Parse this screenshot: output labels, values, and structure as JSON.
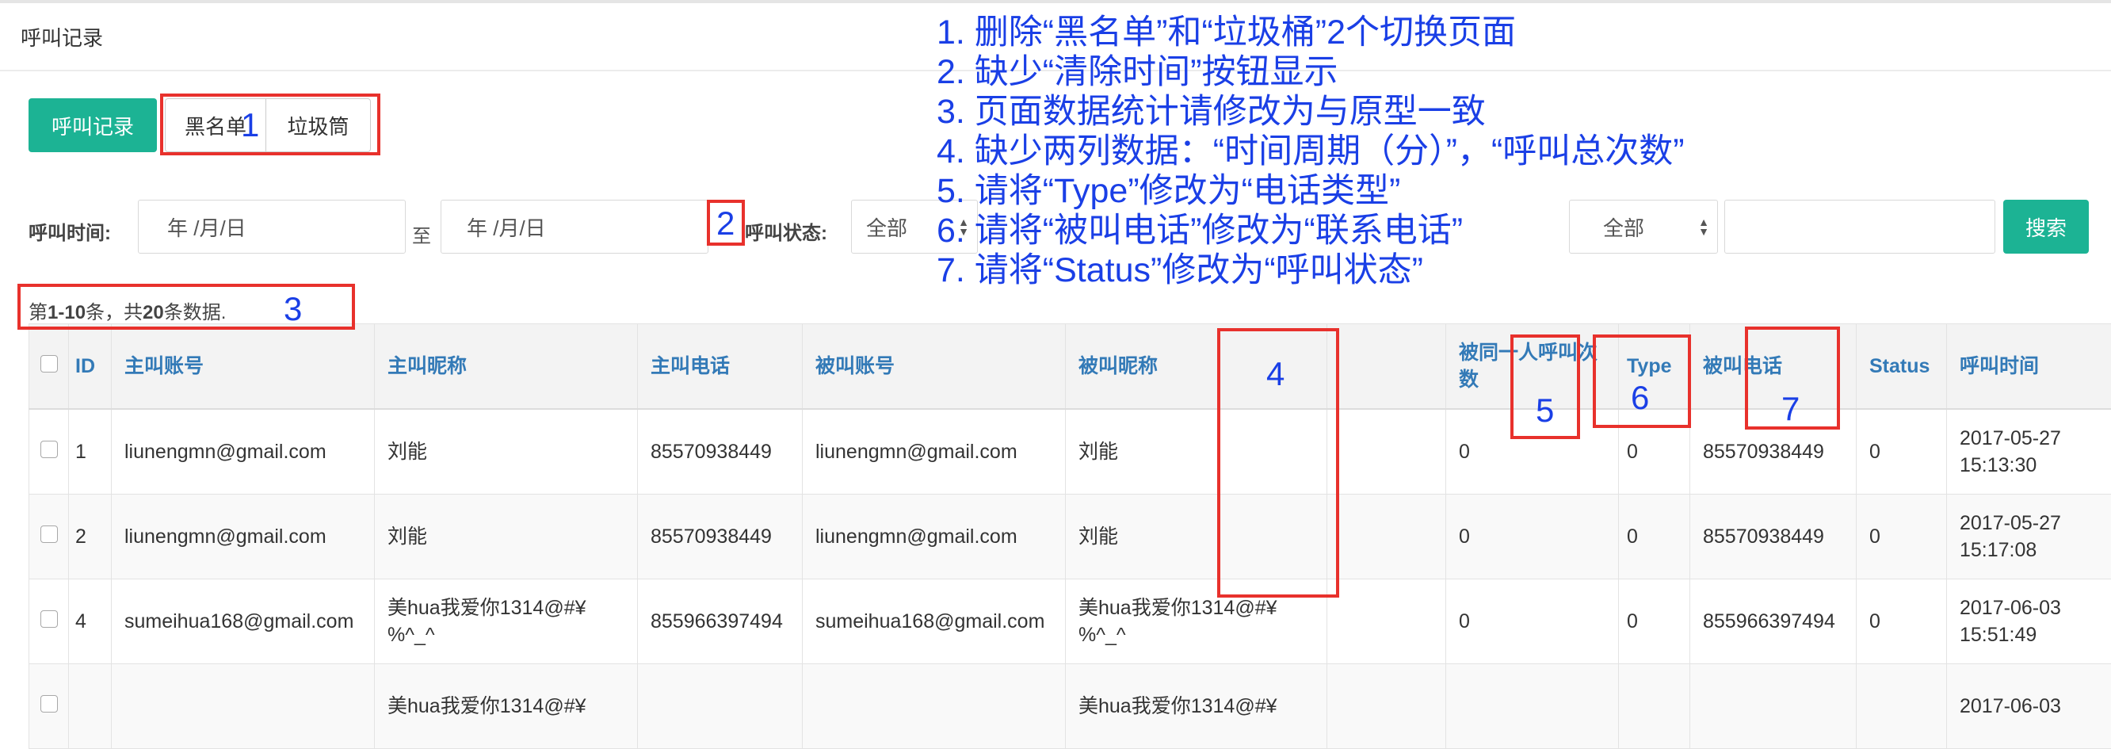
{
  "page": {
    "title": "呼叫记录"
  },
  "tabs": {
    "active": "呼叫记录",
    "blacklist": "黑名单",
    "trash": "垃圾筒"
  },
  "filters": {
    "call_time_label": "呼叫时间:",
    "date_from": "年 /月/日",
    "to_label": "至",
    "date_to": "年 /月/日",
    "call_status_label": "呼叫状态:",
    "status_value": "全部",
    "type_value": "全部",
    "keyword_value": "",
    "search_label": "搜索"
  },
  "summary": {
    "prefix": "第",
    "range": "1-10",
    "mid": "条，共",
    "total": "20",
    "suffix": "条数据."
  },
  "table": {
    "headers": {
      "id": "ID",
      "caller_account": "主叫账号",
      "caller_nickname": "主叫昵称",
      "caller_phone": "主叫电话",
      "callee_account": "被叫账号",
      "callee_nickname": "被叫昵称",
      "blank": "",
      "same_person_count": "被同一人呼叫次数",
      "type": "Type",
      "callee_phone": "被叫电话",
      "status": "Status",
      "call_time": "呼叫时间",
      "ops": ""
    },
    "rows": [
      {
        "id": "1",
        "caller_account": "liunengmn@gmail.com",
        "caller_nickname": "刘能",
        "caller_phone": "85570938449",
        "callee_account": "liunengmn@gmail.com",
        "callee_nickname": "刘能",
        "same_person_count": "0",
        "type": "0",
        "callee_phone": "85570938449",
        "status": "0",
        "call_date": "2017-05-27",
        "call_clock": "15:13:30"
      },
      {
        "id": "2",
        "caller_account": "liunengmn@gmail.com",
        "caller_nickname": "刘能",
        "caller_phone": "85570938449",
        "callee_account": "liunengmn@gmail.com",
        "callee_nickname": "刘能",
        "same_person_count": "0",
        "type": "0",
        "callee_phone": "85570938449",
        "status": "0",
        "call_date": "2017-05-27",
        "call_clock": "15:17:08"
      },
      {
        "id": "4",
        "caller_account": "sumeihua168@gmail.com",
        "caller_nickname": "美hua我爱你1314@#¥%^_^",
        "caller_phone": "855966397494",
        "callee_account": "sumeihua168@gmail.com",
        "callee_nickname": "美hua我爱你1314@#¥%^_^",
        "same_person_count": "0",
        "type": "0",
        "callee_phone": "855966397494",
        "status": "0",
        "call_date": "2017-06-03",
        "call_clock": "15:51:49"
      },
      {
        "id": "",
        "caller_account": "",
        "caller_nickname": "美hua我爱你1314@#¥",
        "caller_phone": "",
        "callee_account": "",
        "callee_nickname": "美hua我爱你1314@#¥",
        "same_person_count": "",
        "type": "",
        "callee_phone": "",
        "status": "",
        "call_date": "2017-06-03",
        "call_clock": ""
      }
    ]
  },
  "annotations": {
    "markers": [
      "1",
      "2",
      "3",
      "4",
      "5",
      "6",
      "7"
    ],
    "notes": [
      "1. 删除“黑名单”和“垃圾桶”2个切换页面",
      "2. 缺少“清除时间”按钮显示",
      "3. 页面数据统计请修改为与原型一致",
      "4. 缺少两列数据：“时间周期（分）”，“呼叫总次数”",
      "5. 请将“Type”修改为“电话类型”",
      "6. 请将“被叫电话”修改为“联系电话”",
      "7. 请将“Status”修改为“呼叫状态”"
    ],
    "note_color": "#1a3fe6",
    "box_color": "#e8312c"
  },
  "colors": {
    "accent": "#1cb394",
    "link": "#337ab7"
  }
}
